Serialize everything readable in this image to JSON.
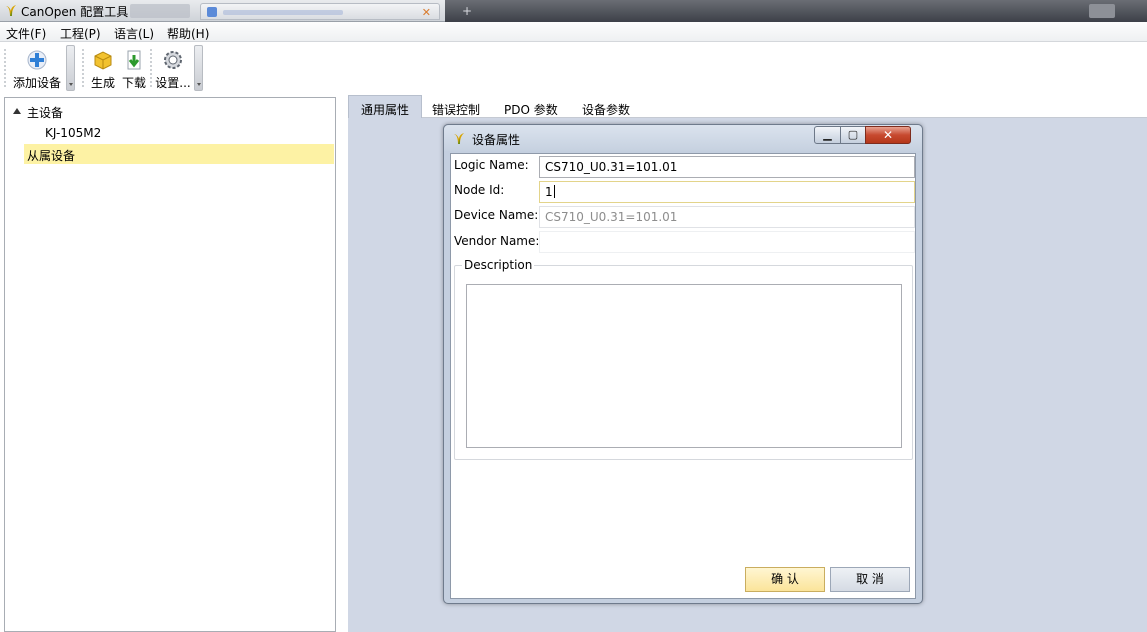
{
  "window": {
    "title": "CanOpen 配置工具",
    "close_glyph": "✕",
    "new_tab_glyph": "+"
  },
  "menu": {
    "items": [
      "文件(F)",
      "工程(P)",
      "语言(L)",
      "帮助(H)"
    ]
  },
  "toolbar": {
    "add_device": "添加设备",
    "generate": "生成",
    "download": "下载",
    "settings": "设置..."
  },
  "tree": {
    "root": "主设备",
    "child": "KJ-105M2",
    "slave": "从属设备"
  },
  "tabs": [
    "通用属性",
    "错误控制",
    "PDO 参数",
    "设备参数"
  ],
  "dialog": {
    "title": "设备属性",
    "minimize_glyph": "▁",
    "maximize_glyph": "▢",
    "close_glyph": "✕",
    "logic_name_label": "Logic Name:",
    "logic_name_value": "CS710_U0.31=101.01",
    "node_id_label": "Node Id:",
    "node_id_value": "1",
    "device_name_label": "Device Name:",
    "device_name_value": "CS710_U0.31=101.01",
    "vendor_name_label": "Vendor Name:",
    "vendor_name_value": "",
    "description_label": "Description",
    "description_value": "",
    "ok_button": "确 认",
    "cancel_button": "取 消"
  },
  "colors": {
    "tab_body": "#d0d7e5",
    "selection": "#fdf2a4",
    "ok_button": "#fbe49a"
  }
}
